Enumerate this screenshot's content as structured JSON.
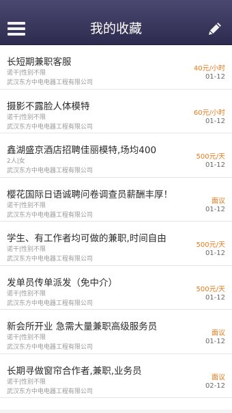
{
  "header": {
    "title": "我的收藏"
  },
  "jobs": [
    {
      "title": "长短期兼职客服",
      "meta": "诺干|性别不限",
      "company": "武汉东方中电电器工程有限公司",
      "pay": "40元/小时",
      "date": "01-12"
    },
    {
      "title": "摄影不露脸人体模特",
      "meta": "诺干|性别不限",
      "company": "武汉东方中电电器工程有限公司",
      "pay": "60元/小时",
      "date": "01-12"
    },
    {
      "title": "鑫湖盛京酒店招聘佳丽模特,场均400",
      "meta": "2人|女",
      "company": "武汉东方中电电器工程有限公司",
      "pay": "500元/天",
      "date": "01-12"
    },
    {
      "title": "樱花国际日语诚聘问卷调查员薪酬丰厚！",
      "meta": "诺干|性别不限",
      "company": "武汉东方中电电器工程有限公司",
      "pay": "面议",
      "date": "01-12"
    },
    {
      "title": "学生、有工作者均可做的兼职,时间自由",
      "meta": "诺干|性别不限",
      "company": "武汉东方中电电器工程有限公司",
      "pay": "500元/天",
      "date": "01-12"
    },
    {
      "title": "发单员传单派发（免中介）",
      "meta": "诺干|性别不限",
      "company": "武汉东方中电电器工程有限公司",
      "pay": "500元/天",
      "date": "01-12"
    },
    {
      "title": "新会所开业 急需大量兼职高级服务员",
      "meta": "诺干|性别不限",
      "company": "武汉东方中电电器工程有限公司",
      "pay": "面议",
      "date": "01-12"
    },
    {
      "title": "长期寻做窗帘合作者,兼职,业务员",
      "meta": "诺干|性别不限",
      "company": "武汉东方中电电器工程有限公司",
      "pay": "面议",
      "date": "02-12"
    }
  ],
  "icons": {
    "menu": "hamburger-menu-icon",
    "edit": "pencil-icon"
  },
  "colors": {
    "header": "#2d2b4e",
    "pay": "#e87a1a"
  }
}
